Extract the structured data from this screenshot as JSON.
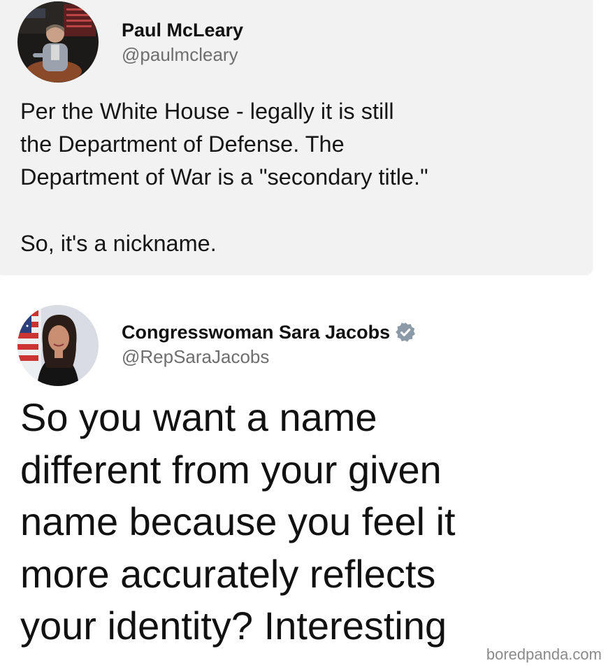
{
  "quoted_post": {
    "author_name": "Paul McLeary",
    "author_handle": "@paulmcleary",
    "avatar_icon": "person-portrait-avatar",
    "body_lines": [
      "Per the White House - legally it is still",
      "the Department of Defense. The",
      "Department of War is a \"secondary title.\""
    ],
    "body_closing": "So, it's a nickname."
  },
  "reply_post": {
    "author_name": "Congresswoman Sara Jacobs",
    "author_handle": "@RepSaraJacobs",
    "avatar_icon": "person-portrait-avatar",
    "verified_icon": "verified-badge-icon",
    "verified_color": "#8c9aa8",
    "body_lines": [
      "So you want a name",
      "different from your given",
      "name because you feel it",
      "more accurately reflects",
      "your identity? Interesting"
    ]
  },
  "watermark": "boredpanda.com",
  "colors": {
    "card_background": "#f2f2f2",
    "page_background": "#ffffff",
    "handle_gray": "#6e6e6e"
  }
}
